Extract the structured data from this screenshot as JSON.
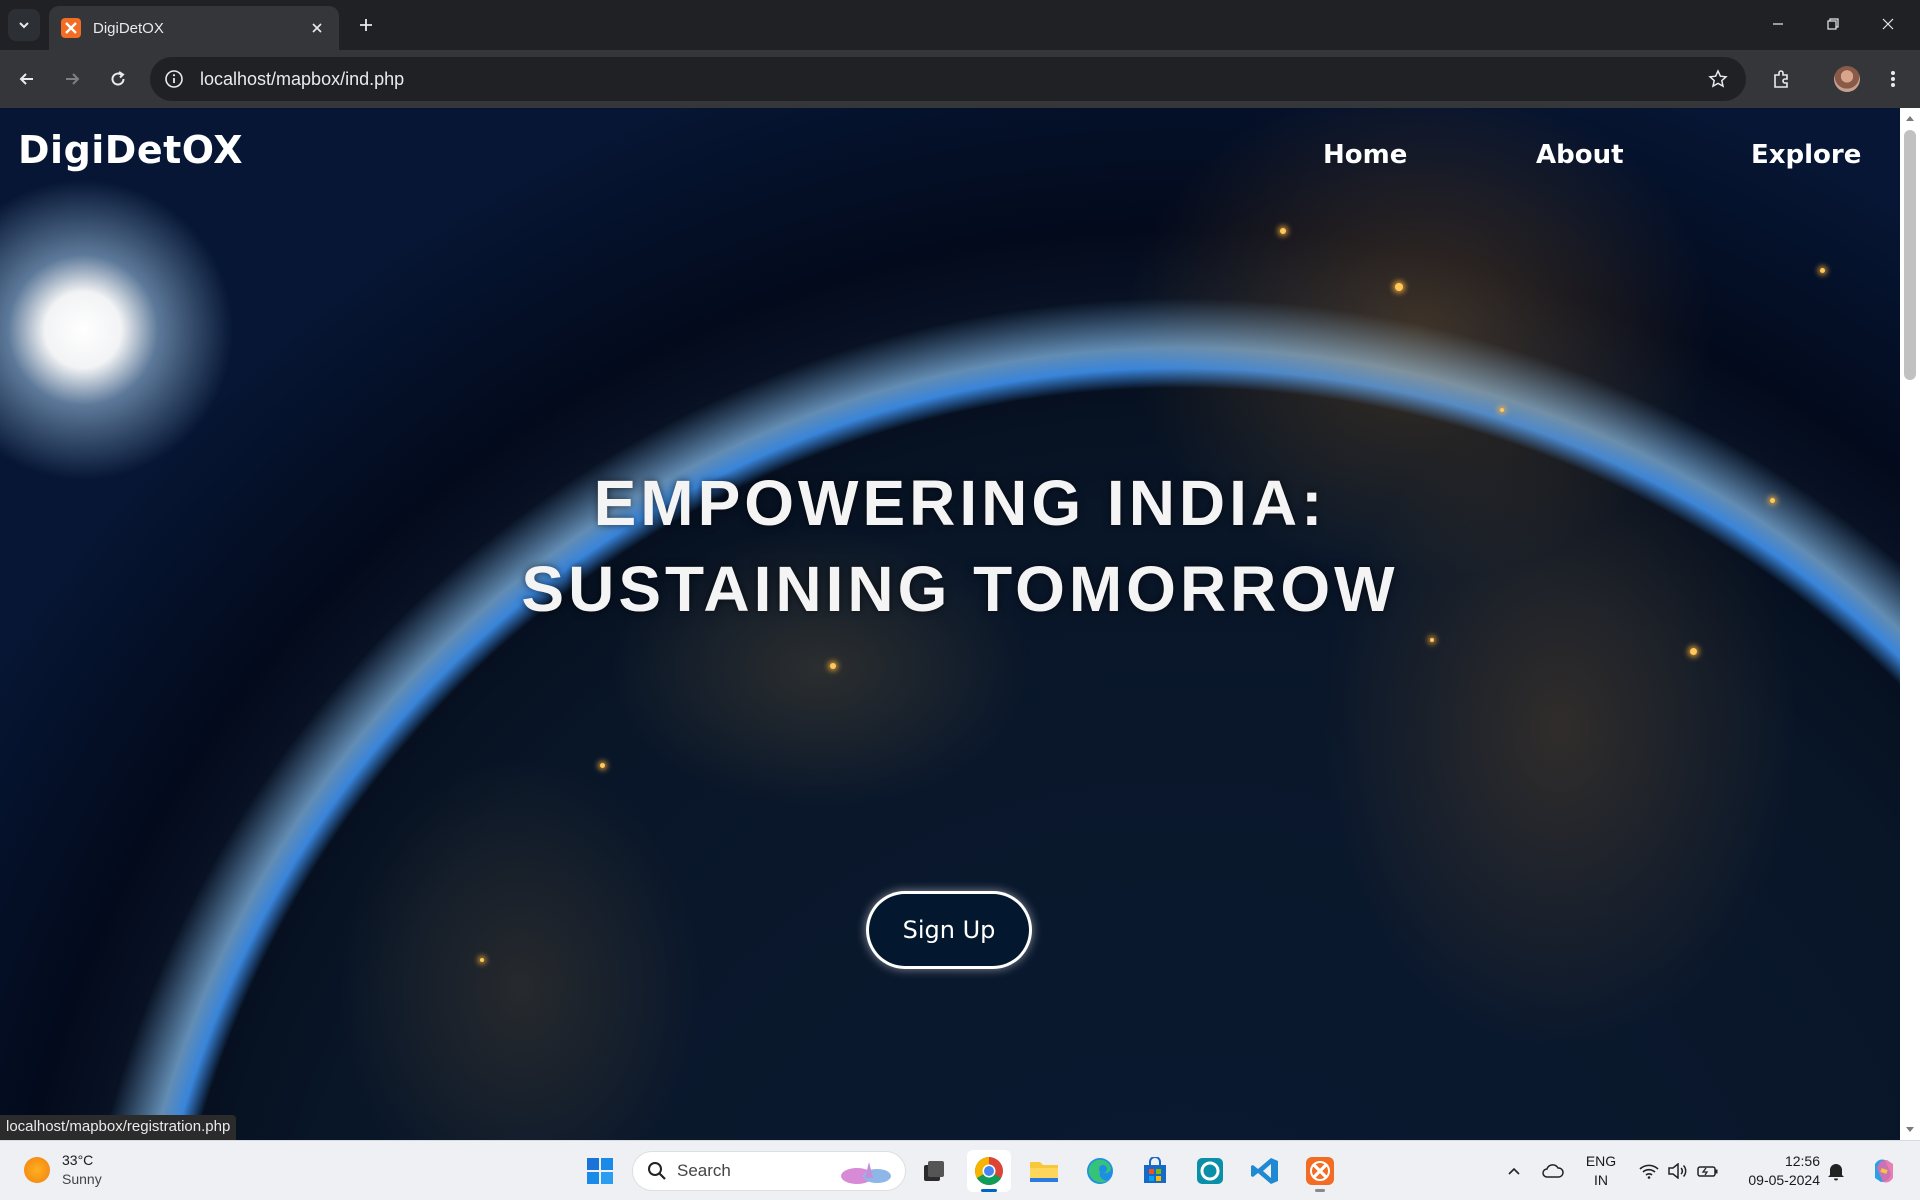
{
  "browser": {
    "tab": {
      "title": "DigiDetOX"
    },
    "omnibox": {
      "url": "localhost/mapbox/ind.php"
    },
    "status_bar_url": "localhost/mapbox/registration.php"
  },
  "site": {
    "logo": "DigiDetOX",
    "nav": [
      {
        "label": "Home"
      },
      {
        "label": "About"
      },
      {
        "label": "Explore"
      }
    ],
    "hero": {
      "line1": "EMPOWERING INDIA:",
      "line2": "SUSTAINING TOMORROW"
    },
    "signup_label": "Sign Up"
  },
  "taskbar": {
    "weather": {
      "temp": "33°C",
      "condition": "Sunny"
    },
    "search_placeholder": "Search",
    "apps": [
      "windows-start",
      "chrome",
      "file-explorer",
      "edge",
      "microsoft-store",
      "cortana",
      "vscode",
      "xampp"
    ],
    "language": {
      "line1": "ENG",
      "line2": "IN"
    },
    "clock": {
      "time": "12:56",
      "date": "09-05-2024"
    }
  },
  "colors": {
    "chrome_dark": "#1f2124",
    "toolbar": "#35363a",
    "button_bg": "#03182e",
    "taskbar": "#eef0f4",
    "accent": "#0067c0"
  }
}
